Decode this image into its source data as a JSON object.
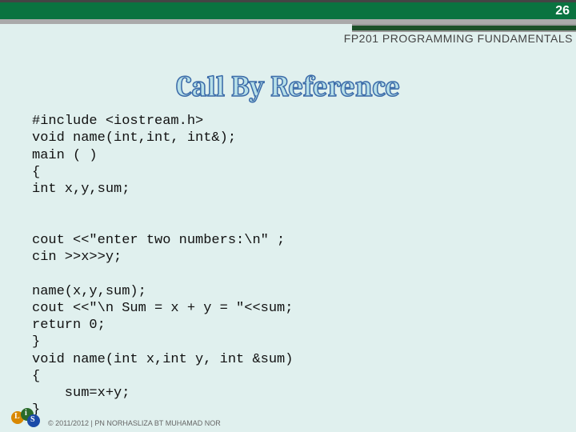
{
  "page_number": "26",
  "course_label": "FP201 PROGRAMMING FUNDAMENTALS",
  "slide_title": "Call By Reference",
  "code": "#include <iostream.h>\nvoid name(int,int, int&);\nmain ( )\n{\nint x,y,sum;\n\n\ncout <<\"enter two numbers:\\n\" ;\ncin >>x>>y;\n\nname(x,y,sum);\ncout <<\"\\n Sum = x + y = \"<<sum;\nreturn 0;\n}\nvoid name(int x,int y, int &sum)\n{\n    sum=x+y;\n}",
  "footer": "© 2011/2012 | PN NORHASLIZA BT MUHAMAD NOR",
  "logo_letters": {
    "a": "L",
    "b": "i",
    "c": "S"
  }
}
